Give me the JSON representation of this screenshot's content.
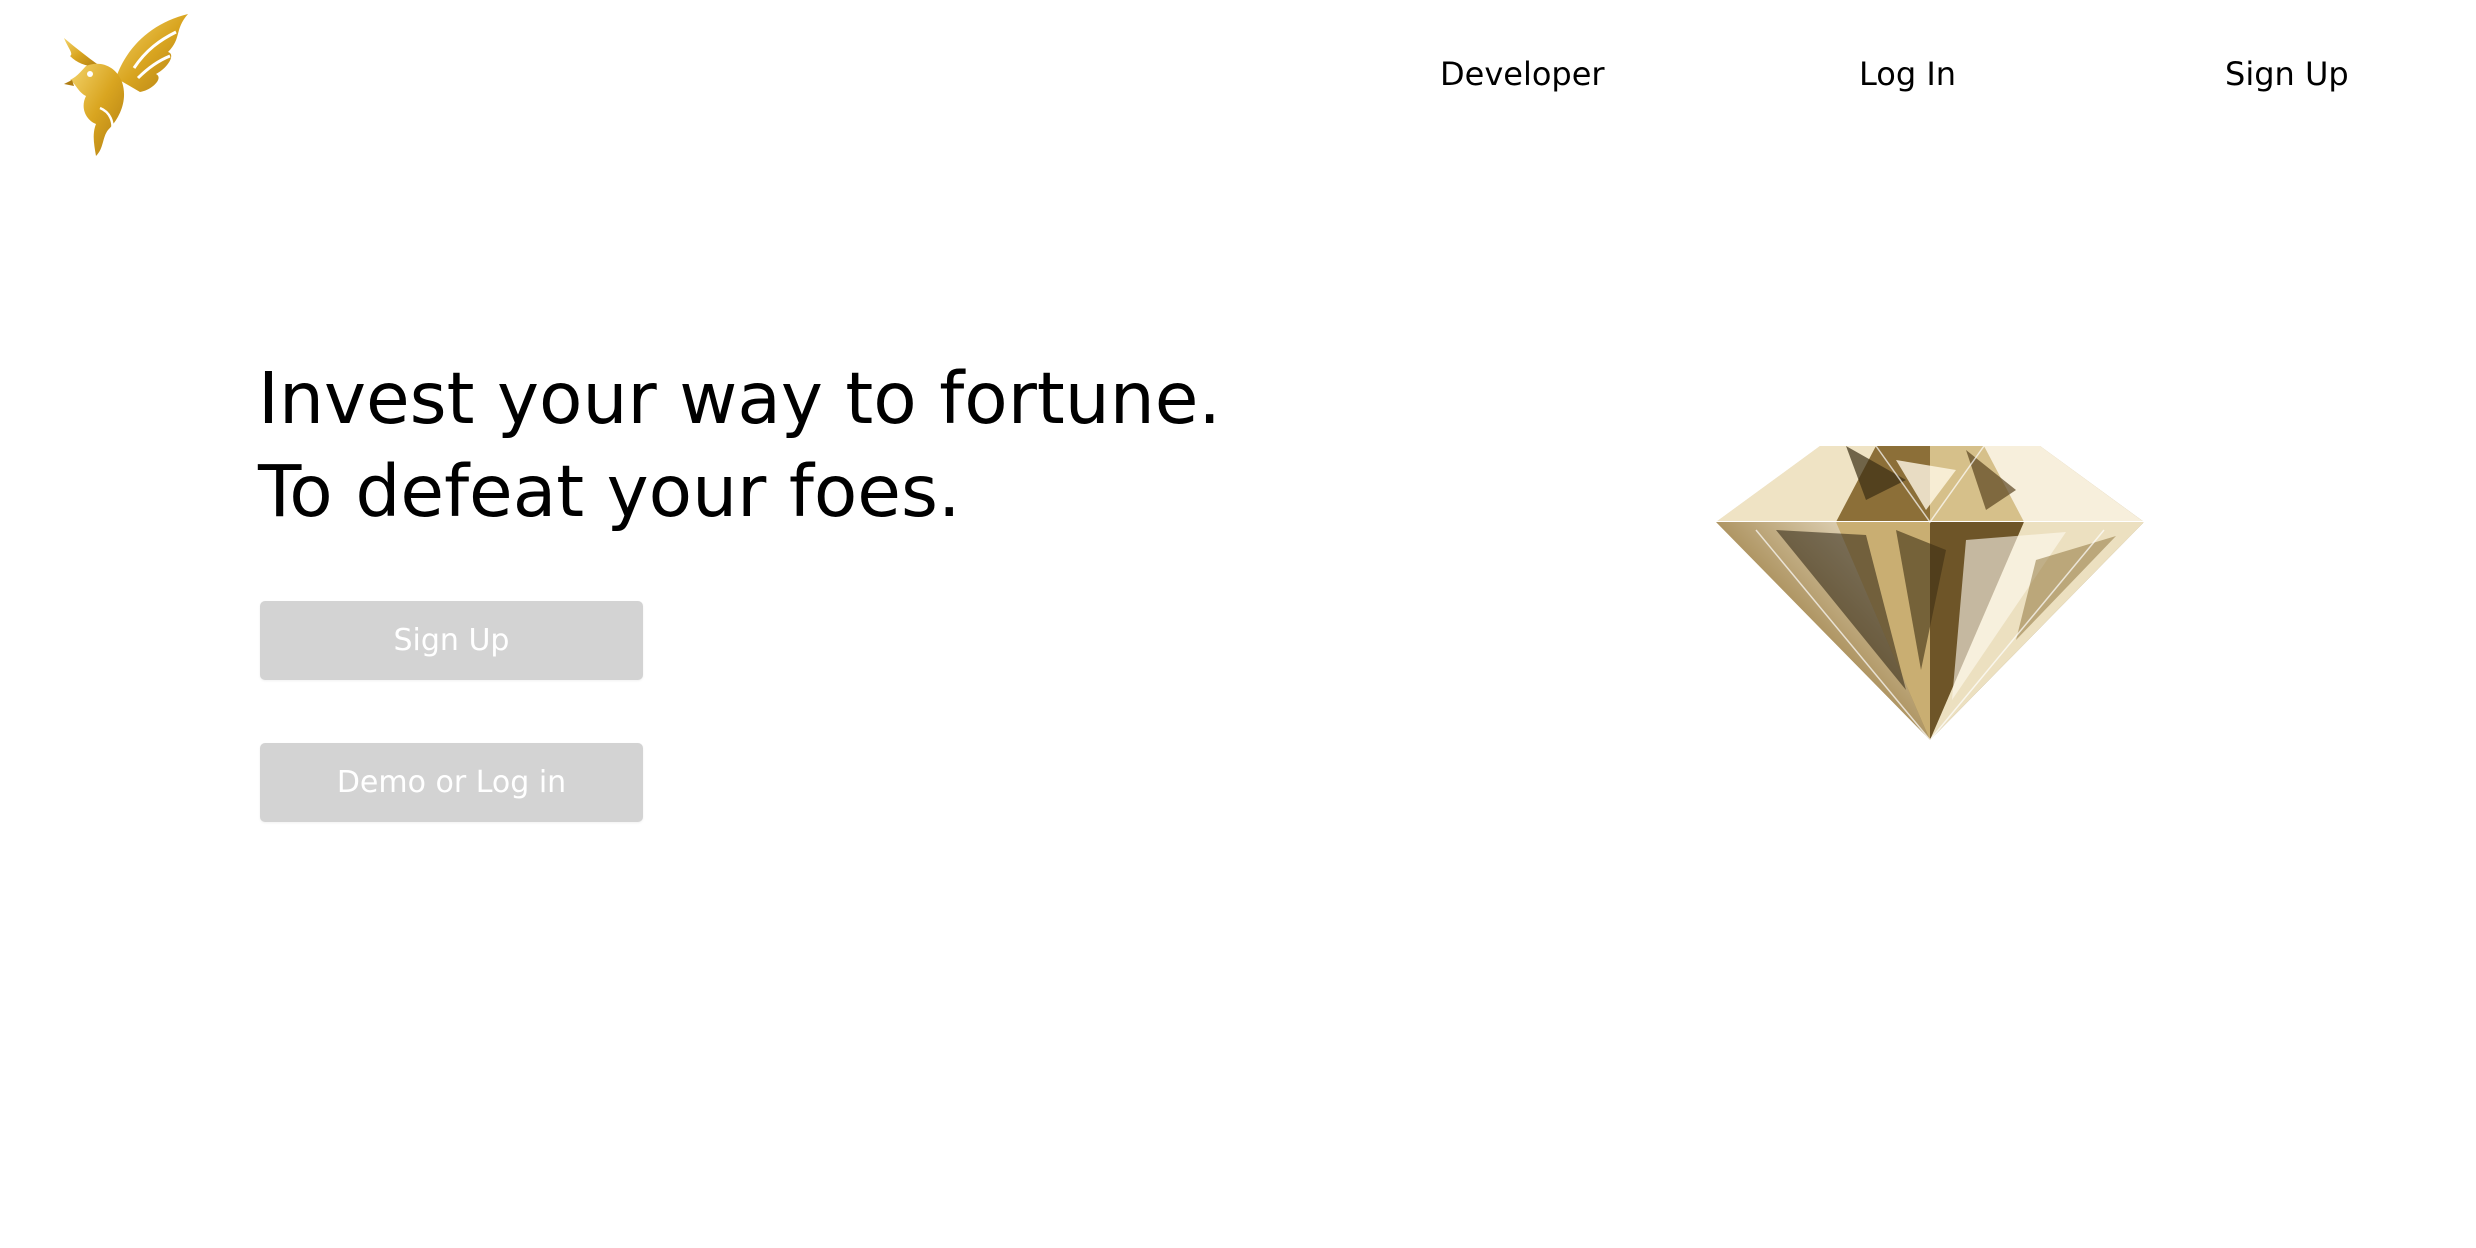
{
  "header": {
    "logo_icon": "eagle-icon",
    "nav": {
      "developer": "Developer",
      "login": "Log In",
      "signup": "Sign Up"
    }
  },
  "hero": {
    "title_line1": "Invest your way to fortune.",
    "title_line2": "To defeat your foes.",
    "signup_button": "Sign Up",
    "demo_button": "Demo or Log in",
    "image_icon": "diamond-icon"
  },
  "colors": {
    "background": "#ffffff",
    "button_bg": "#d3d3d3",
    "button_text": "#ffffff",
    "gold": "#d4a017"
  }
}
